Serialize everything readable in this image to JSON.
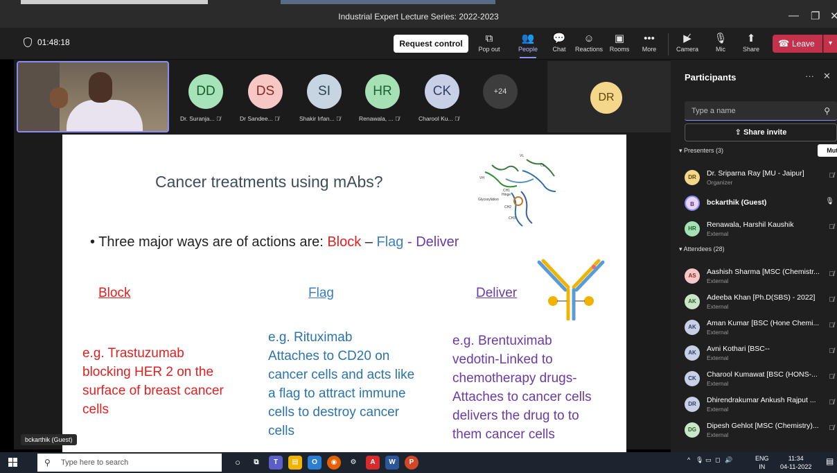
{
  "window": {
    "title": "Industrial Expert Lecture Series: 2022-2023"
  },
  "toolbar": {
    "timer": "01:48:18",
    "request_control": "Request control",
    "items": [
      {
        "label": "Pop out",
        "icon": "pop-out-icon"
      },
      {
        "label": "People",
        "icon": "people-icon"
      },
      {
        "label": "Chat",
        "icon": "chat-icon"
      },
      {
        "label": "Reactions",
        "icon": "reactions-icon"
      },
      {
        "label": "Rooms",
        "icon": "rooms-icon"
      },
      {
        "label": "More",
        "icon": "more-icon"
      },
      {
        "label": "Camera",
        "icon": "camera-off-icon"
      },
      {
        "label": "Mic",
        "icon": "mic-off-icon"
      },
      {
        "label": "Share",
        "icon": "share-icon"
      }
    ],
    "leave": "Leave"
  },
  "stage": {
    "avatars": [
      {
        "initials": "DD",
        "name": "Dr. Suranja...",
        "bg": "#a7e3b8",
        "fg": "#155e2a"
      },
      {
        "initials": "DS",
        "name": "Dr Sandee...",
        "bg": "#f6c7c4",
        "fg": "#8a2621"
      },
      {
        "initials": "SI",
        "name": "Shakir Irfan...",
        "bg": "#c7d4e1",
        "fg": "#2e4257"
      },
      {
        "initials": "HR",
        "name": "Renawala, ...",
        "bg": "#a6e1b5",
        "fg": "#1d6331"
      },
      {
        "initials": "CK",
        "name": "Charool Ku...",
        "bg": "#c8d0e7",
        "fg": "#313f66"
      }
    ],
    "more_count": "+24",
    "spotlight_initials": "DR",
    "self_tag": "bckarthik (Guest)"
  },
  "slide": {
    "title": "Cancer treatments using mAbs?",
    "bullet_prefix": "• Three major ways are of actions are: ",
    "block": "Block",
    "dash1": " – ",
    "flag": "Flag",
    "dash2": " - ",
    "deliver": "Deliver",
    "col_block": "Block",
    "col_flag": "Flag",
    "col_deliver": "Deliver",
    "block_text": [
      "e.g. Trastuzumab",
      "blocking HER 2 on the",
      "surface of breast cancer",
      "cells"
    ],
    "flag_text": [
      "e.g. Rituximab",
      "Attaches to CD20 on",
      "cancer cells and acts like",
      "a flag to attract immune",
      "cells to destroy cancer",
      "cells"
    ],
    "deliver_text": [
      "e.g. Brentuximab",
      "vedotin-Linked to",
      "chemotherapy drugs-",
      "Attaches to cancer cells",
      "delivers the drug to to",
      "them cancer cells"
    ],
    "struct_labels": {
      "vl": "VL",
      "vh": "VH",
      "cl": "CL",
      "ch1": "CH1",
      "hinge": "Hinge",
      "glyco": "Glycosylation",
      "ch2": "CH2",
      "ch3": "CH3"
    }
  },
  "panel": {
    "title": "Participants",
    "search_placeholder": "Type a name",
    "share_invite": "Share invite",
    "presenters_label": "Presenters (3)",
    "mute_all": "Mute all",
    "attendees_label": "Attendees (28)",
    "presenters": [
      {
        "initials": "DR",
        "name": "Dr. Sriparna Ray [MU - Jaipur]",
        "sub": "Organizer",
        "bg": "#f5d78b",
        "fg": "#5b4500"
      },
      {
        "initials": "B",
        "name": "bckarthik (Guest)",
        "sub": "",
        "bg": "#e8d6f5",
        "fg": "#5b2d82"
      },
      {
        "initials": "HR",
        "name": "Renawala, Harshil Kaushik",
        "sub": "External",
        "bg": "#a6e1b5",
        "fg": "#1d6331"
      }
    ],
    "attendees": [
      {
        "initials": "AS",
        "name": "Aashish Sharma [MSC (Chemistr...",
        "sub": "External",
        "bg": "#f6c7c4",
        "fg": "#8a2621"
      },
      {
        "initials": "AK",
        "name": "Adeeba Khan [Ph.D(SBS) - 2022]",
        "sub": "External",
        "bg": "#c9e6c9",
        "fg": "#2c5e2c"
      },
      {
        "initials": "AK",
        "name": "Aman Kumar [BSC (Hone Chemi...",
        "sub": "External",
        "bg": "#c8d0e7",
        "fg": "#313f66"
      },
      {
        "initials": "AK",
        "name": "Avni Kothari [BSC--",
        "sub": "External",
        "bg": "#c8d0e7",
        "fg": "#313f66"
      },
      {
        "initials": "CK",
        "name": "Charool Kumawat [BSC (HONS-...",
        "sub": "External",
        "bg": "#c8d0e7",
        "fg": "#313f66"
      },
      {
        "initials": "DR",
        "name": "Dhirendrakumar Ankush Rajput ...",
        "sub": "External",
        "bg": "#c8d0e7",
        "fg": "#313f66"
      },
      {
        "initials": "DG",
        "name": "Dipesh Gehlot [MSC (Chemistry)...",
        "sub": "External",
        "bg": "#c9e6c9",
        "fg": "#2c5e2c"
      }
    ]
  },
  "taskbar": {
    "search_placeholder": "Type here to search",
    "lang1": "ENG",
    "lang2": "IN",
    "time": "11:34",
    "date": "04-11-2022"
  }
}
